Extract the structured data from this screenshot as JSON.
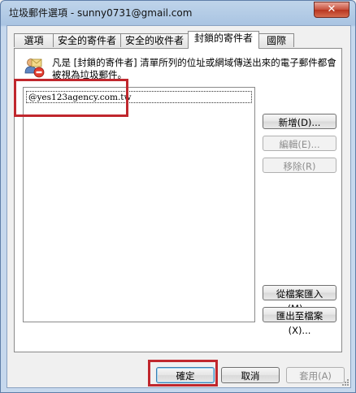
{
  "window": {
    "title": "垃圾郵件選項 - sunny0731@gmail.com",
    "close": "✕"
  },
  "tabs": [
    "選項",
    "安全的寄件者",
    "安全的收件者",
    "封鎖的寄件者",
    "國際"
  ],
  "panel": {
    "description": "凡是 [封鎖的寄件者] 清單所列的位址或網域傳送出來的電子郵件都會被視為垃圾郵件。",
    "blocked_list": [
      "@yes123agency.com.tw"
    ]
  },
  "side_buttons": {
    "add": "新增(D)...",
    "edit": "編輯(E)...",
    "remove": "移除(R)",
    "import": "從檔案匯入(M)...",
    "export": "匯出至檔案(X)..."
  },
  "footer": {
    "ok": "確定",
    "cancel": "取消",
    "apply": "套用(A)"
  },
  "colors": {
    "highlight": "#c0272d",
    "title_bar": "#bfd4ea"
  }
}
